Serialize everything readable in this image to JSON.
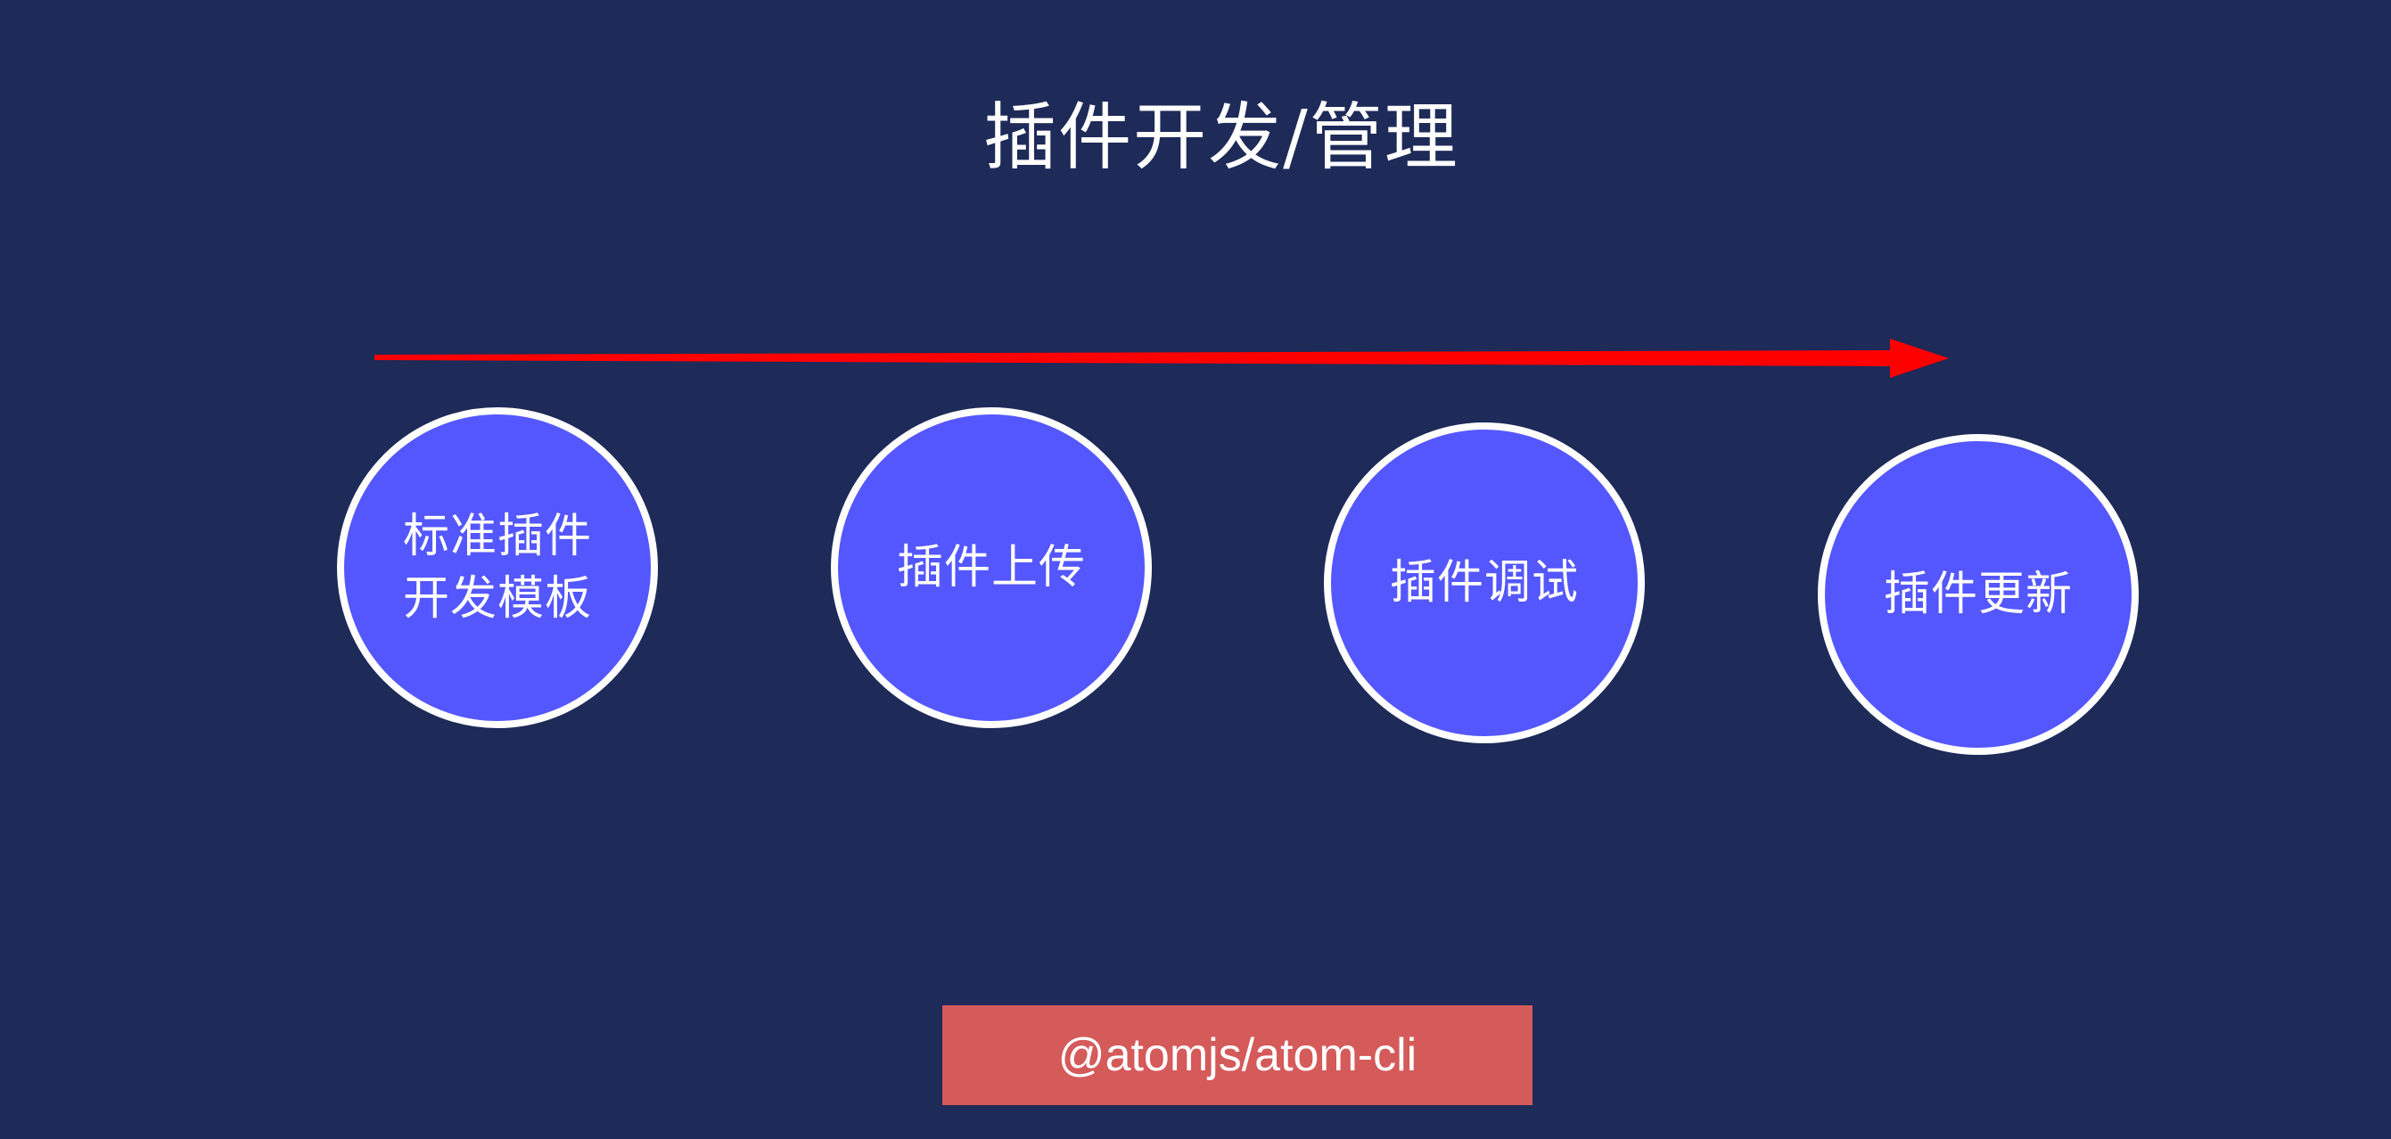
{
  "slide": {
    "title": "插件开发/管理",
    "steps": [
      {
        "label": "标准插件\n开发模板"
      },
      {
        "label": "插件上传"
      },
      {
        "label": "插件调试"
      },
      {
        "label": "插件更新"
      }
    ],
    "package_tag": "@atomjs/atom-cli"
  },
  "colors": {
    "background": "#1e2a58",
    "node_fill": "#5457fd",
    "node_border": "#ffffff",
    "arrow": "#ff0000",
    "tag_fill": "#d55a5a"
  }
}
